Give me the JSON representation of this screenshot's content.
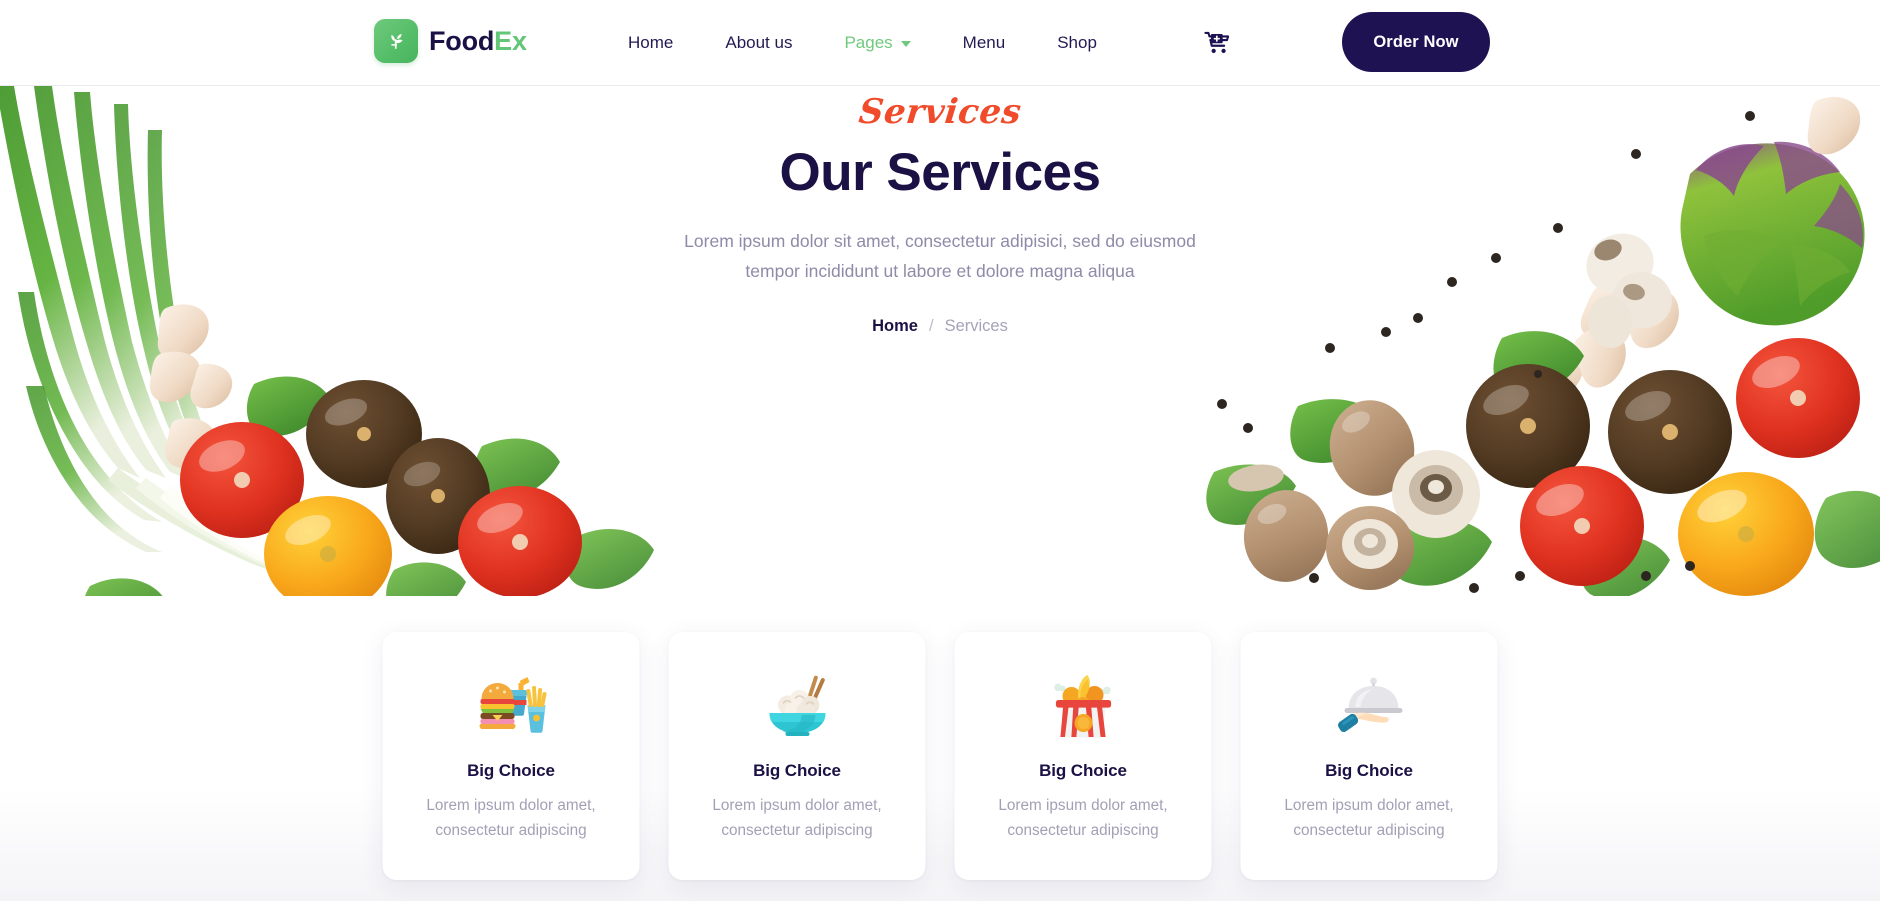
{
  "brand": {
    "name_part1": "Food",
    "name_part2": "Ex",
    "logo_icon": "sprout-leaf-icon",
    "logo_color": "#5cbf6e",
    "text_color_primary": "#1b1145",
    "text_color_accent": "#63c677"
  },
  "nav": {
    "items": [
      {
        "label": "Home",
        "active": false,
        "has_dropdown": false
      },
      {
        "label": "About us",
        "active": false,
        "has_dropdown": false
      },
      {
        "label": "Pages",
        "active": true,
        "has_dropdown": true
      },
      {
        "label": "Menu",
        "active": false,
        "has_dropdown": false
      },
      {
        "label": "Shop",
        "active": false,
        "has_dropdown": false
      }
    ],
    "cart_icon": "shopping-cart-plus-icon",
    "order_button_label": "Order Now",
    "order_button_bg": "#1e1252",
    "active_color": "#6fc97c"
  },
  "hero": {
    "eyebrow": "Services",
    "eyebrow_color": "#f04b2a",
    "title": "Our Services",
    "title_color": "#1b1145",
    "subtitle_line1": "Lorem ipsum dolor sit amet, consectetur adipisici, sed do eiusmod",
    "subtitle_line2": "tempor incididunt ut labore et dolore magna aliqua",
    "subtitle_color": "#8e8aa8",
    "breadcrumb": {
      "home_label": "Home",
      "separator": "/",
      "current_label": "Services"
    },
    "decor_left": "vegetables-scallions-tomatoes-garlic-spinach",
    "decor_right": "vegetables-mushrooms-tomatoes-lettuce-spinach-peppercorns"
  },
  "services": {
    "cards": [
      {
        "icon": "burger-fries-drink-icon",
        "title": "Big Choice",
        "desc_line1": "Lorem ipsum dolor amet,",
        "desc_line2": "consectetur adipiscing"
      },
      {
        "icon": "noodle-bowl-chopsticks-icon",
        "title": "Big Choice",
        "desc_line1": "Lorem ipsum dolor amet,",
        "desc_line2": "consectetur adipiscing"
      },
      {
        "icon": "fried-chicken-bucket-icon",
        "title": "Big Choice",
        "desc_line1": "Lorem ipsum dolor amet,",
        "desc_line2": "consectetur adipiscing"
      },
      {
        "icon": "hand-serving-cloche-icon",
        "title": "Big Choice",
        "desc_line1": "Lorem ipsum dolor amet,",
        "desc_line2": "consectetur adipiscing"
      }
    ]
  }
}
